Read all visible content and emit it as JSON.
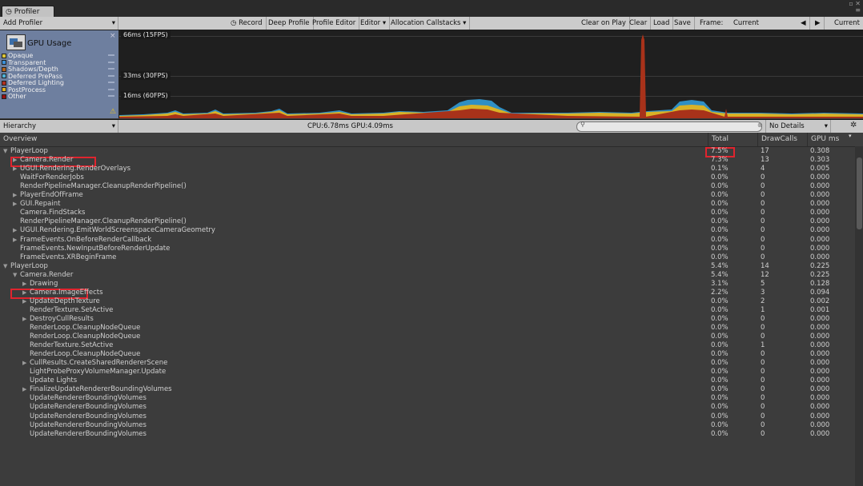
{
  "window": {
    "tab_label": "Profiler",
    "controls": "▫ ✕\n  ▪≡"
  },
  "toolbar": {
    "add_profiler": "Add Profiler",
    "record": "Record",
    "deep_profile": "Deep Profile",
    "profile_editor": "Profile Editor",
    "editor": "Editor",
    "allocation_callstacks": "Allocation Callstacks",
    "clear_on_play": "Clear on Play",
    "clear": "Clear",
    "load": "Load",
    "save": "Save",
    "frame_label": "Frame:",
    "frame_value": "Current",
    "prev": "◀",
    "next": "▶",
    "current": "Current"
  },
  "legend": {
    "title": "GPU Usage",
    "items": [
      {
        "label": "Opaque",
        "color": "#d9c43a"
      },
      {
        "label": "Transparent",
        "color": "#3a8fd9"
      },
      {
        "label": "Shadows/Depth",
        "color": "#b5651d"
      },
      {
        "label": "Deferred PrePass",
        "color": "#4fb0d6"
      },
      {
        "label": "Deferred Lighting",
        "color": "#b03020"
      },
      {
        "label": "PostProcess",
        "color": "#e0b020"
      },
      {
        "label": "Other",
        "color": "#9a1010"
      }
    ]
  },
  "graph": {
    "top_label": "66ms (15FPS)",
    "mid_label": "33ms (30FPS)",
    "low_label": "16ms (60FPS)"
  },
  "hierarchy_bar": {
    "view": "Hierarchy",
    "stats": "CPU:6.78ms   GPU:4.09ms",
    "search_placeholder": "",
    "details": "No Details"
  },
  "table": {
    "headers": {
      "overview": "Overview",
      "total": "Total",
      "drawcalls": "DrawCalls",
      "gpums": "GPU ms"
    },
    "rows": [
      {
        "indent": 0,
        "arrow": "down",
        "name": "PlayerLoop",
        "total": "7.5%",
        "dc": "17",
        "gpu": "0.308"
      },
      {
        "indent": 1,
        "arrow": "right",
        "name": "Camera.Render",
        "total": "7.3%",
        "dc": "13",
        "gpu": "0.303"
      },
      {
        "indent": 1,
        "arrow": "right",
        "name": "UGUI.Rendering.RenderOverlays",
        "total": "0.1%",
        "dc": "4",
        "gpu": "0.005"
      },
      {
        "indent": 1,
        "arrow": "",
        "name": "WaitForRenderJobs",
        "total": "0.0%",
        "dc": "0",
        "gpu": "0.000"
      },
      {
        "indent": 1,
        "arrow": "",
        "name": "RenderPipelineManager.CleanupRenderPipeline()",
        "total": "0.0%",
        "dc": "0",
        "gpu": "0.000"
      },
      {
        "indent": 1,
        "arrow": "right",
        "name": "PlayerEndOfFrame",
        "total": "0.0%",
        "dc": "0",
        "gpu": "0.000"
      },
      {
        "indent": 1,
        "arrow": "right",
        "name": "GUI.Repaint",
        "total": "0.0%",
        "dc": "0",
        "gpu": "0.000"
      },
      {
        "indent": 1,
        "arrow": "",
        "name": "Camera.FindStacks",
        "total": "0.0%",
        "dc": "0",
        "gpu": "0.000"
      },
      {
        "indent": 1,
        "arrow": "",
        "name": "RenderPipelineManager.CleanupRenderPipeline()",
        "total": "0.0%",
        "dc": "0",
        "gpu": "0.000"
      },
      {
        "indent": 1,
        "arrow": "right",
        "name": "UGUI.Rendering.EmitWorldScreenspaceCameraGeometry",
        "total": "0.0%",
        "dc": "0",
        "gpu": "0.000"
      },
      {
        "indent": 1,
        "arrow": "right",
        "name": "FrameEvents.OnBeforeRenderCallback",
        "total": "0.0%",
        "dc": "0",
        "gpu": "0.000"
      },
      {
        "indent": 1,
        "arrow": "",
        "name": "FrameEvents.NewInputBeforeRenderUpdate",
        "total": "0.0%",
        "dc": "0",
        "gpu": "0.000"
      },
      {
        "indent": 1,
        "arrow": "",
        "name": "FrameEvents.XRBeginFrame",
        "total": "0.0%",
        "dc": "0",
        "gpu": "0.000"
      },
      {
        "indent": 0,
        "arrow": "down",
        "name": "PlayerLoop",
        "total": "5.4%",
        "dc": "14",
        "gpu": "0.225"
      },
      {
        "indent": 1,
        "arrow": "down",
        "name": "Camera.Render",
        "total": "5.4%",
        "dc": "12",
        "gpu": "0.225"
      },
      {
        "indent": 2,
        "arrow": "right",
        "name": "Drawing",
        "total": "3.1%",
        "dc": "5",
        "gpu": "0.128"
      },
      {
        "indent": 2,
        "arrow": "right",
        "name": "Camera.ImageEffects",
        "total": "2.2%",
        "dc": "3",
        "gpu": "0.094"
      },
      {
        "indent": 2,
        "arrow": "right",
        "name": "UpdateDepthTexture",
        "total": "0.0%",
        "dc": "2",
        "gpu": "0.002"
      },
      {
        "indent": 2,
        "arrow": "",
        "name": "RenderTexture.SetActive",
        "total": "0.0%",
        "dc": "1",
        "gpu": "0.001"
      },
      {
        "indent": 2,
        "arrow": "right",
        "name": "DestroyCullResults",
        "total": "0.0%",
        "dc": "0",
        "gpu": "0.000"
      },
      {
        "indent": 2,
        "arrow": "",
        "name": "RenderLoop.CleanupNodeQueue",
        "total": "0.0%",
        "dc": "0",
        "gpu": "0.000"
      },
      {
        "indent": 2,
        "arrow": "",
        "name": "RenderLoop.CleanupNodeQueue",
        "total": "0.0%",
        "dc": "0",
        "gpu": "0.000"
      },
      {
        "indent": 2,
        "arrow": "",
        "name": "RenderTexture.SetActive",
        "total": "0.0%",
        "dc": "1",
        "gpu": "0.000"
      },
      {
        "indent": 2,
        "arrow": "",
        "name": "RenderLoop.CleanupNodeQueue",
        "total": "0.0%",
        "dc": "0",
        "gpu": "0.000"
      },
      {
        "indent": 2,
        "arrow": "right",
        "name": "CullResults.CreateSharedRendererScene",
        "total": "0.0%",
        "dc": "0",
        "gpu": "0.000"
      },
      {
        "indent": 2,
        "arrow": "",
        "name": "LightProbeProxyVolumeManager.Update",
        "total": "0.0%",
        "dc": "0",
        "gpu": "0.000"
      },
      {
        "indent": 2,
        "arrow": "",
        "name": "Update Lights",
        "total": "0.0%",
        "dc": "0",
        "gpu": "0.000"
      },
      {
        "indent": 2,
        "arrow": "right",
        "name": "FinalizeUpdateRendererBoundingVolumes",
        "total": "0.0%",
        "dc": "0",
        "gpu": "0.000"
      },
      {
        "indent": 2,
        "arrow": "",
        "name": "UpdateRendererBoundingVolumes",
        "total": "0.0%",
        "dc": "0",
        "gpu": "0.000"
      },
      {
        "indent": 2,
        "arrow": "",
        "name": "UpdateRendererBoundingVolumes",
        "total": "0.0%",
        "dc": "0",
        "gpu": "0.000"
      },
      {
        "indent": 2,
        "arrow": "",
        "name": "UpdateRendererBoundingVolumes",
        "total": "0.0%",
        "dc": "0",
        "gpu": "0.000"
      },
      {
        "indent": 2,
        "arrow": "",
        "name": "UpdateRendererBoundingVolumes",
        "total": "0.0%",
        "dc": "0",
        "gpu": "0.000"
      },
      {
        "indent": 2,
        "arrow": "",
        "name": "UpdateRendererBoundingVolumes",
        "total": "0.0%",
        "dc": "0",
        "gpu": "0.000"
      }
    ]
  }
}
